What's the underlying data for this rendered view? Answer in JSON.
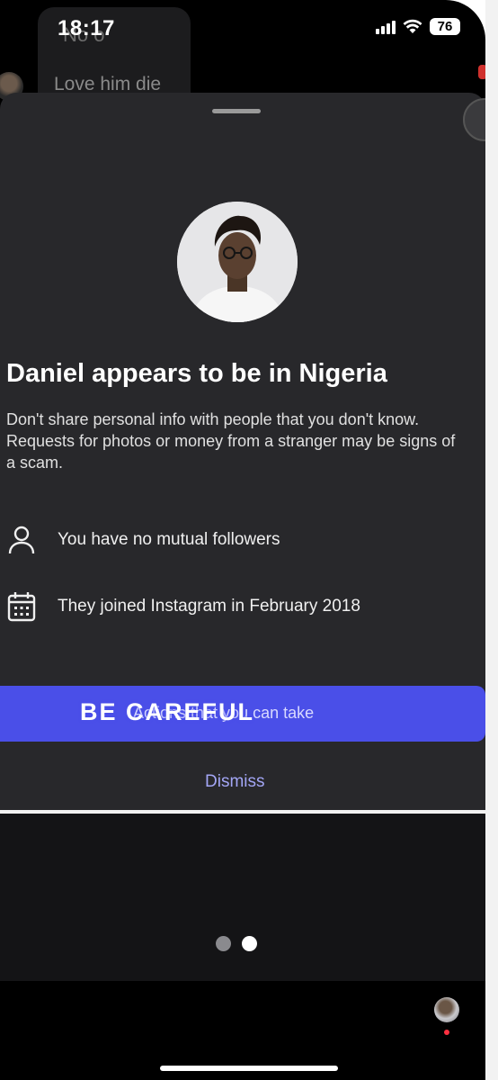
{
  "status_bar": {
    "time": "18:17",
    "battery": "76",
    "icons": [
      "signal-icon",
      "wifi-icon",
      "battery-icon"
    ]
  },
  "background_chat": {
    "name_fragment": "No o",
    "message": "Love him die"
  },
  "sheet": {
    "headline": "Daniel appears to be in Nigeria",
    "body": "Don't share personal info with people that you don't know. Requests for photos or money from a stranger may be signs of a scam.",
    "info_rows": [
      {
        "icon": "person-icon",
        "text": "You have no mutual followers"
      },
      {
        "icon": "calendar-icon",
        "text": "They joined Instagram in February 2018"
      }
    ],
    "action_button_label": "Actions that you can take",
    "overlay_caption": "BE CAREFUL",
    "dismiss_label": "Dismiss"
  },
  "pager": {
    "count": 2,
    "active_index": 1
  },
  "colors": {
    "accent": "#4a4fe8",
    "sheet_bg": "#28282b",
    "link": "#a3a6f5"
  }
}
